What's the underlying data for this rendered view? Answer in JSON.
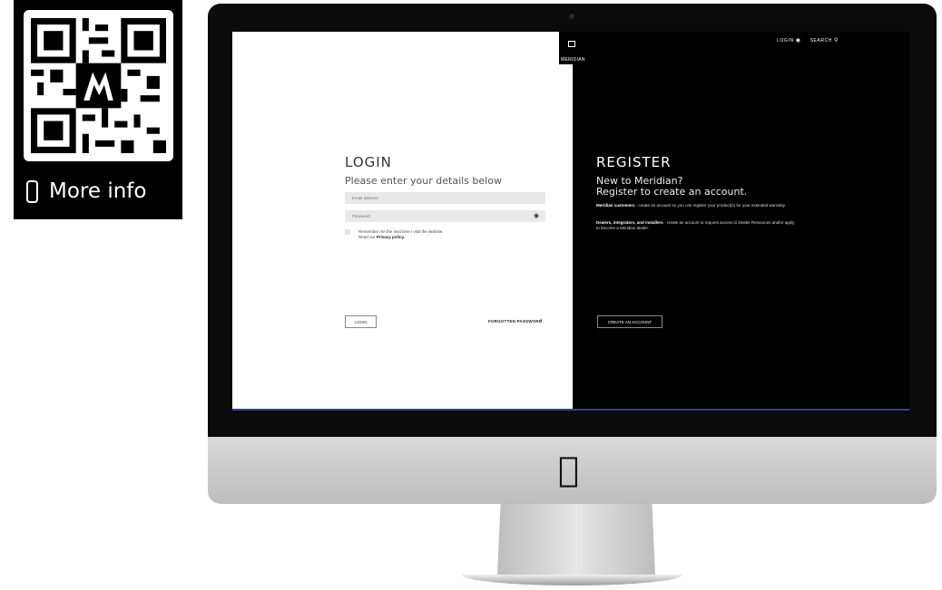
{
  "qr_card": {
    "info_label": "More info",
    "icons": [
      "qr-code-icon",
      "phone-icon"
    ]
  },
  "site": {
    "logo_text": "MERIDIAN",
    "nav": {
      "login": "LOGIN",
      "search": "SEARCH"
    },
    "icons": [
      "user-icon",
      "search-icon",
      "eye-icon",
      "chevron-right-icon",
      "apple-icon"
    ]
  },
  "login": {
    "title": "LOGIN",
    "subtitle": "Please enter your details below",
    "email_placeholder": "Email address",
    "password_placeholder": "Password",
    "remember_text": "Remember me the next time I visit the website.",
    "read_our": "Read our",
    "privacy_link": "Privacy policy.",
    "submit_label": "LOGIN",
    "forgot_label": "FORGOTTEN PASSWORD"
  },
  "register": {
    "title": "REGISTER",
    "subtitle_1": "New to Meridian?",
    "subtitle_2": "Register to create an account.",
    "customers_bold": "Meridian customers",
    "customers_text": " - create an account so you can register your product(s) for your extended warranty.",
    "dealers_bold": "Dealers, integrators, and installers",
    "dealers_text": " - create an account to request access to Dealer Resources and/or apply to become a Meridian dealer.",
    "create_label": "CREATE AN ACCOUNT"
  },
  "colors": {
    "accent_line": "#3a3f9a",
    "register_bg": "#000000",
    "login_bg": "#ffffff"
  }
}
